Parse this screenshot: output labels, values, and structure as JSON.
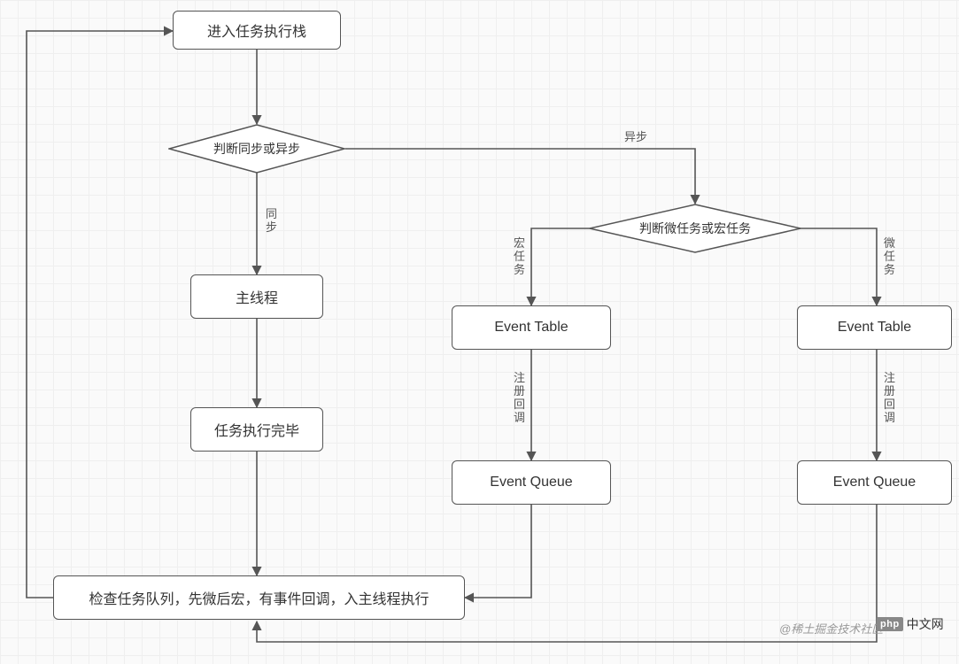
{
  "nodes": {
    "enter_stack": "进入任务执行栈",
    "decision_sync": "判断同步或异步",
    "main_thread": "主线程",
    "task_done": "任务执行完毕",
    "check_queue": "检查任务队列，先微后宏，有事件回调，入主线程执行",
    "decision_micro_macro": "判断微任务或宏任务",
    "event_table_left": "Event Table",
    "event_queue_left": "Event Queue",
    "event_table_right": "Event Table",
    "event_queue_right": "Event Queue"
  },
  "edges": {
    "sync": "同\n步",
    "async": "异步",
    "macro": "宏\n任\n务",
    "micro": "微\n任\n务",
    "register_cb_left": "注\n册\n回\n调",
    "register_cb_right": "注\n册\n回\n调"
  },
  "watermark": "@稀土掘金技术社区",
  "logo_text": "中文网",
  "logo_badge": "php"
}
